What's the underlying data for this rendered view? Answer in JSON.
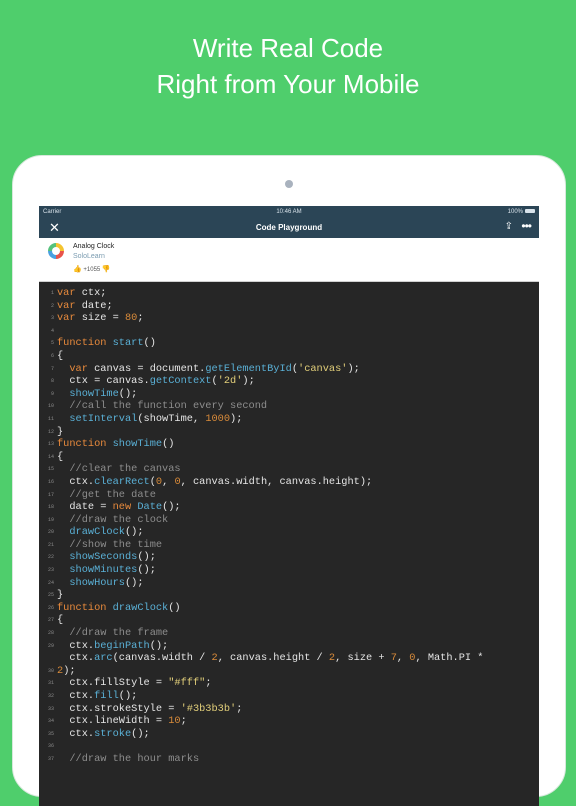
{
  "headline": {
    "line1": "Write Real Code",
    "line2": "Right from Your Mobile"
  },
  "status_bar": {
    "carrier": "Carrier",
    "time": "10:46 AM",
    "battery": "100%"
  },
  "nav": {
    "close_icon": "close-icon",
    "title": "Code Playground",
    "share_icon": "share-icon",
    "more_icon": "more-icon"
  },
  "code_header": {
    "title": "Analog Clock",
    "author": "SoloLearn",
    "votes": "+1055"
  },
  "code_lines": [
    [
      [
        "kw",
        "var"
      ],
      [
        "t",
        " ctx;"
      ]
    ],
    [
      [
        "kw",
        "var"
      ],
      [
        "t",
        " date;"
      ]
    ],
    [
      [
        "kw",
        "var"
      ],
      [
        "t",
        " size = "
      ],
      [
        "num",
        "80"
      ],
      [
        "t",
        ";"
      ]
    ],
    [],
    [
      [
        "kw",
        "function"
      ],
      [
        "t",
        " "
      ],
      [
        "fn",
        "start"
      ],
      [
        "t",
        "()"
      ]
    ],
    [
      [
        "t",
        "{"
      ]
    ],
    [
      [
        "t",
        "  "
      ],
      [
        "kw",
        "var"
      ],
      [
        "t",
        " canvas = document."
      ],
      [
        "fn",
        "getElementById"
      ],
      [
        "t",
        "("
      ],
      [
        "str",
        "'canvas'"
      ],
      [
        "t",
        ");"
      ]
    ],
    [
      [
        "t",
        "  ctx = canvas."
      ],
      [
        "fn",
        "getContext"
      ],
      [
        "t",
        "("
      ],
      [
        "str",
        "'2d'"
      ],
      [
        "t",
        ");"
      ]
    ],
    [
      [
        "t",
        "  "
      ],
      [
        "fn",
        "showTime"
      ],
      [
        "t",
        "();"
      ]
    ],
    [
      [
        "t",
        "  "
      ],
      [
        "cm",
        "//call the function every second"
      ]
    ],
    [
      [
        "t",
        "  "
      ],
      [
        "fn",
        "setInterval"
      ],
      [
        "t",
        "(showTime, "
      ],
      [
        "num",
        "1000"
      ],
      [
        "t",
        ");"
      ]
    ],
    [
      [
        "t",
        "}"
      ]
    ],
    [
      [
        "kw",
        "function"
      ],
      [
        "t",
        " "
      ],
      [
        "fn",
        "showTime"
      ],
      [
        "t",
        "()"
      ]
    ],
    [
      [
        "t",
        "{"
      ]
    ],
    [
      [
        "t",
        "  "
      ],
      [
        "cm",
        "//clear the canvas"
      ]
    ],
    [
      [
        "t",
        "  ctx."
      ],
      [
        "fn",
        "clearRect"
      ],
      [
        "t",
        "("
      ],
      [
        "num",
        "0"
      ],
      [
        "t",
        ", "
      ],
      [
        "num",
        "0"
      ],
      [
        "t",
        ", canvas.width, canvas.height);"
      ]
    ],
    [
      [
        "t",
        "  "
      ],
      [
        "cm",
        "//get the date"
      ]
    ],
    [
      [
        "t",
        "  date = "
      ],
      [
        "kw",
        "new"
      ],
      [
        "t",
        " "
      ],
      [
        "fn",
        "Date"
      ],
      [
        "t",
        "();"
      ]
    ],
    [
      [
        "t",
        "  "
      ],
      [
        "cm",
        "//draw the clock"
      ]
    ],
    [
      [
        "t",
        "  "
      ],
      [
        "fn",
        "drawClock"
      ],
      [
        "t",
        "();"
      ]
    ],
    [
      [
        "t",
        "  "
      ],
      [
        "cm",
        "//show the time"
      ]
    ],
    [
      [
        "t",
        "  "
      ],
      [
        "fn",
        "showSeconds"
      ],
      [
        "t",
        "();"
      ]
    ],
    [
      [
        "t",
        "  "
      ],
      [
        "fn",
        "showMinutes"
      ],
      [
        "t",
        "();"
      ]
    ],
    [
      [
        "t",
        "  "
      ],
      [
        "fn",
        "showHours"
      ],
      [
        "t",
        "();"
      ]
    ],
    [
      [
        "t",
        "}"
      ]
    ],
    [
      [
        "kw",
        "function"
      ],
      [
        "t",
        " "
      ],
      [
        "fn",
        "drawClock"
      ],
      [
        "t",
        "()"
      ]
    ],
    [
      [
        "t",
        "{"
      ]
    ],
    [
      [
        "t",
        "  "
      ],
      [
        "cm",
        "//draw the frame"
      ]
    ],
    [
      [
        "t",
        "  ctx."
      ],
      [
        "fn",
        "beginPath"
      ],
      [
        "t",
        "();"
      ]
    ],
    [
      [
        "t",
        "  ctx."
      ],
      [
        "fn",
        "arc"
      ],
      [
        "t",
        "(canvas.width / "
      ],
      [
        "num",
        "2"
      ],
      [
        "t",
        ", canvas.height / "
      ],
      [
        "num",
        "2"
      ],
      [
        "t",
        ", size + "
      ],
      [
        "num",
        "7"
      ],
      [
        "t",
        ", "
      ],
      [
        "num",
        "0"
      ],
      [
        "t",
        ", Math.PI *"
      ]
    ],
    [
      [
        "num",
        "2"
      ],
      [
        "t",
        ");"
      ]
    ],
    [
      [
        "t",
        "  ctx.fillStyle = "
      ],
      [
        "str",
        "\"#fff\""
      ],
      [
        "t",
        ";"
      ]
    ],
    [
      [
        "t",
        "  ctx."
      ],
      [
        "fn",
        "fill"
      ],
      [
        "t",
        "();"
      ]
    ],
    [
      [
        "t",
        "  ctx.strokeStyle = "
      ],
      [
        "str",
        "'#3b3b3b'"
      ],
      [
        "t",
        ";"
      ]
    ],
    [
      [
        "t",
        "  ctx.lineWidth = "
      ],
      [
        "num",
        "10"
      ],
      [
        "t",
        ";"
      ]
    ],
    [
      [
        "t",
        "  ctx."
      ],
      [
        "fn",
        "stroke"
      ],
      [
        "t",
        "();"
      ]
    ],
    [],
    [
      [
        "t",
        "  "
      ],
      [
        "cm",
        "//draw the hour marks"
      ]
    ]
  ],
  "line_numbers": [
    "1",
    "2",
    "3",
    "4",
    "5",
    "6",
    "7",
    "8",
    "9",
    "10",
    "11",
    "12",
    "13",
    "14",
    "15",
    "16",
    "17",
    "18",
    "19",
    "20",
    "21",
    "22",
    "23",
    "24",
    "25",
    "26",
    "27",
    "28",
    "29",
    "",
    "30",
    "31",
    "32",
    "33",
    "34",
    "35",
    "36",
    "37"
  ],
  "colors": {
    "background": "#4fce6c",
    "nav": "#2b4556",
    "editor": "#262626",
    "keyword": "#e88a3c",
    "function": "#5ab0d6",
    "number": "#d98b3a",
    "string": "#e2cf7a",
    "comment": "#8d8d8d"
  }
}
